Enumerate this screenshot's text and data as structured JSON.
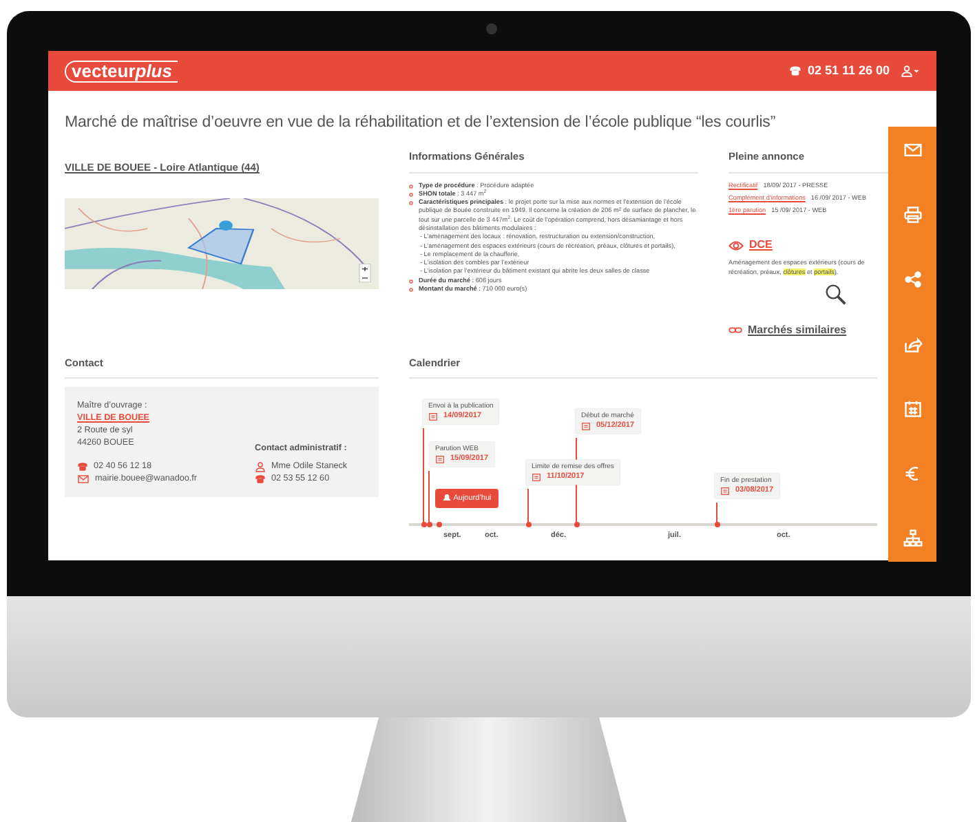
{
  "header": {
    "logo_main": "vecteur",
    "logo_accent": "plus",
    "phone": "02 51 11 26 00"
  },
  "title": "Marché de maîtrise d’oeuvre en vue de la réhabilitation et de l’extension de l’école publique  “les courlis”",
  "location_link": "VILLE DE BOUEE - Loire Atlantique (44)",
  "info": {
    "heading": "Informations Générales",
    "items": [
      {
        "label": "Type de procédure",
        "value": " : Procédure adaptée"
      },
      {
        "label": "SHON totale",
        "value": " : 3 447 m$^{2}$"
      },
      {
        "label": "Caractéristiques principales",
        "value": " : le projet porte sur la mise aux normes et l’extension de l’école publique de Bouée construite en 1949. Il concerne la création de 206 m$^{2}$ de surface de plancher, le tout sur une parcelle de 3 447m$^{2}$. Le coût de l’opération comprend, hors  désamiantage et hors désinstallation des bâtiments modulaires :",
        "details": [
          "- L’aménagement des locaux : rénovation, restructuration ou extension/construction,",
          "- L’aménagement des espaces extérieurs (cours de récréation, préaux, clôtures et portails),",
          "- Le remplacement de la chaufferie,",
          "- L’isolation des combles par l’extérieur",
          "- L’isolation par l’extérieur du bâtiment existant qui abrite les deux salles de classe"
        ]
      },
      {
        "label": "Durée du marché",
        "value": " : 606 jours"
      },
      {
        "label": "Montant du marché",
        "value": " : 710 000 euro(s)"
      }
    ]
  },
  "announcement": {
    "heading": "Pleine annonce",
    "items": [
      {
        "link": "Rectificatif",
        "text": "18/09/ 2017  - PRESSE"
      },
      {
        "link": "Complément d’informations",
        "text": "16 /09/ 2017 - WEB"
      },
      {
        "link": "1ère parution",
        "text": "15 /09/ 2017 - WEB"
      }
    ],
    "dce_link": "DCE",
    "dce_excerpt": [
      {
        "text": "Aménagement des espaces extérieurs (cours de récréation, préaux, ",
        "highlighted": false
      },
      {
        "text": "clôtures",
        "highlighted": true
      },
      {
        "text": " et ",
        "highlighted": false
      },
      {
        "text": "portails",
        "highlighted": true
      },
      {
        "text": ").",
        "highlighted": false
      }
    ],
    "similar_link": "Marchés similaires"
  },
  "contact": {
    "heading": "Contact",
    "owner_label": "Maître d’ouvrage :",
    "owner_link": "VILLE DE BOUEE",
    "address": [
      "2 Route de syl",
      "44260 BOUEE"
    ],
    "phone": "02 40 56 12 18",
    "email": "mairie.bouee@wanadoo.fr",
    "admin_label": "Contact administratif :",
    "admin_name": "Mme Odile Staneck",
    "admin_phone": "02 53 55 12 60"
  },
  "calendar": {
    "heading": "Calendrier",
    "today_button": "Aujourd’hui",
    "events": [
      {
        "label": "Envoi à la publication",
        "date": "14/09/2017"
      },
      {
        "label": "Parution WEB",
        "date": "15/09/2017"
      },
      {
        "label": "Limite de remise des offres",
        "date": "11/10/2017"
      },
      {
        "label": "Début de marché",
        "date": "05/12/2017"
      },
      {
        "label": "Fin de prestation",
        "date": "03/08/2017"
      }
    ],
    "axis_labels": [
      "sept.",
      "oct.",
      "déc.",
      "juil.",
      "oct."
    ]
  },
  "sidebar": [
    {
      "kind": "mail"
    },
    {
      "kind": "print"
    },
    {
      "kind": "share"
    },
    {
      "kind": "export"
    },
    {
      "kind": "calendar"
    },
    {
      "kind": "euro"
    },
    {
      "kind": "sitemap"
    }
  ]
}
